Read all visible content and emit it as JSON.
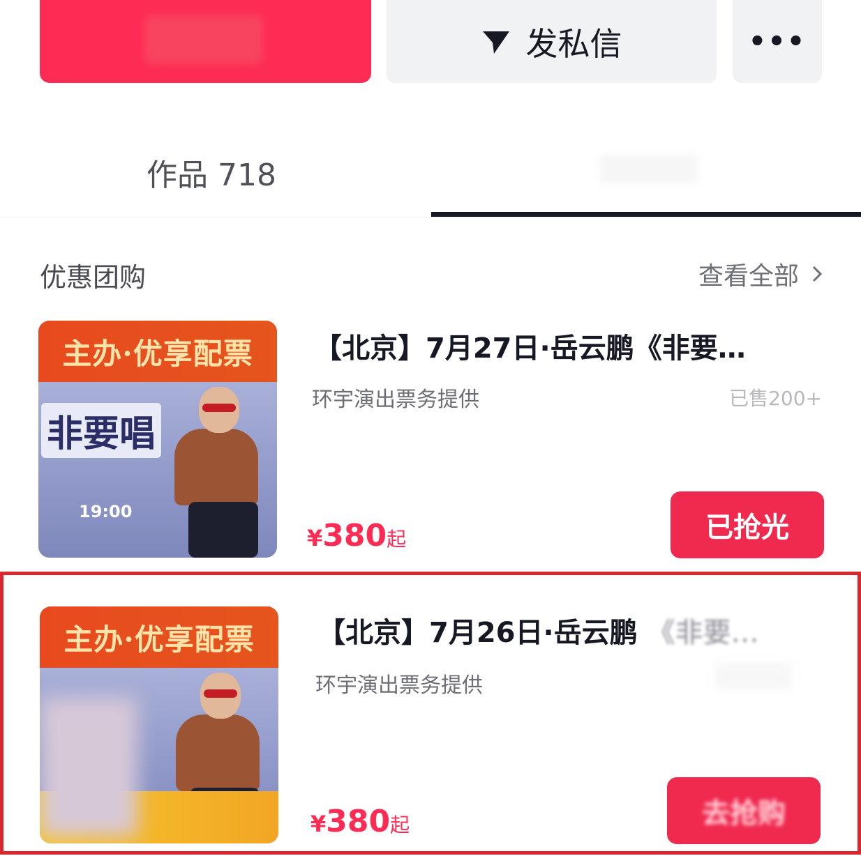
{
  "actions": {
    "message_label": "发私信",
    "more_label": "•••"
  },
  "tabs": {
    "works_label": "作品 718"
  },
  "section": {
    "title": "优惠团购",
    "view_all": "查看全部"
  },
  "deals": [
    {
      "title": "【北京】7月27日·岳云鹏《非要…",
      "title_tail": "",
      "provider": "环宇演出票务提供",
      "sold": "已售200+",
      "price_symbol": "¥",
      "price": "380",
      "price_suffix": "起",
      "button": "已抢光",
      "poster_banner": "主办·优享配票",
      "poster_title": "非要唱",
      "poster_time": "19:00"
    },
    {
      "title": "【北京】7月26日·岳云鹏",
      "title_tail": "《非要…",
      "provider": "环宇演出票务提供",
      "sold": "",
      "price_symbol": "¥",
      "price": "380",
      "price_suffix": "起",
      "button": "去抢购",
      "poster_banner": "主办·优享配票"
    }
  ],
  "colors": {
    "accent": "#fe2c55",
    "highlight_border": "#d8282f"
  }
}
